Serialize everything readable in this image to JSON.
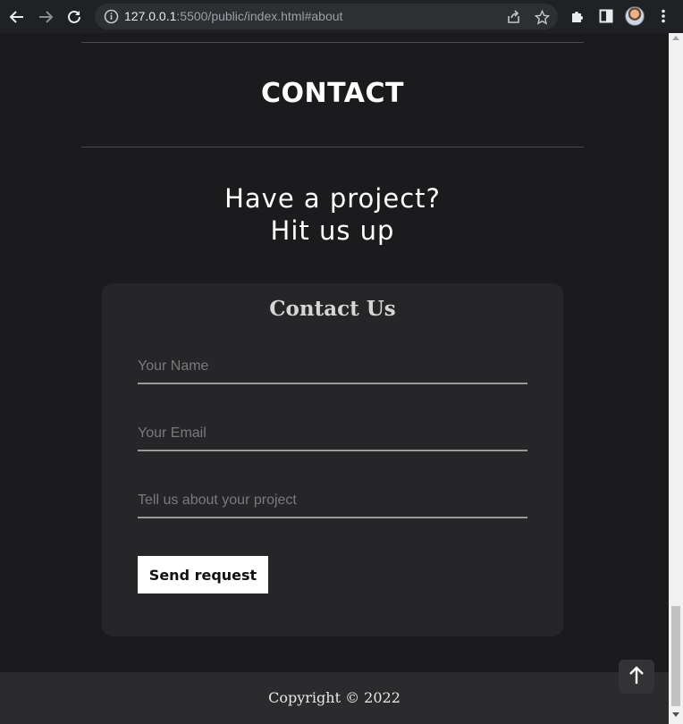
{
  "browser": {
    "url_host": "127.0.0.1",
    "url_rest": ":5500/public/index.html#about"
  },
  "section": {
    "heading": "CONTACT",
    "tagline_line1": "Have a project?",
    "tagline_line2": "Hit us up"
  },
  "form": {
    "title": "Contact Us",
    "name_placeholder": "Your Name",
    "email_placeholder": "Your Email",
    "project_placeholder": "Tell us about your project",
    "submit_label": "Send request"
  },
  "footer": {
    "copyright": "Copyright © 2022"
  },
  "icons": {
    "back": "arrow-left-icon",
    "forward": "arrow-right-icon",
    "reload": "reload-icon",
    "info": "info-icon",
    "share": "share-icon",
    "bookmark": "star-icon",
    "extensions": "puzzle-icon",
    "sidepanel": "side-panel-icon",
    "menu": "kebab-menu-icon",
    "scroll_top": "arrow-up-icon"
  }
}
